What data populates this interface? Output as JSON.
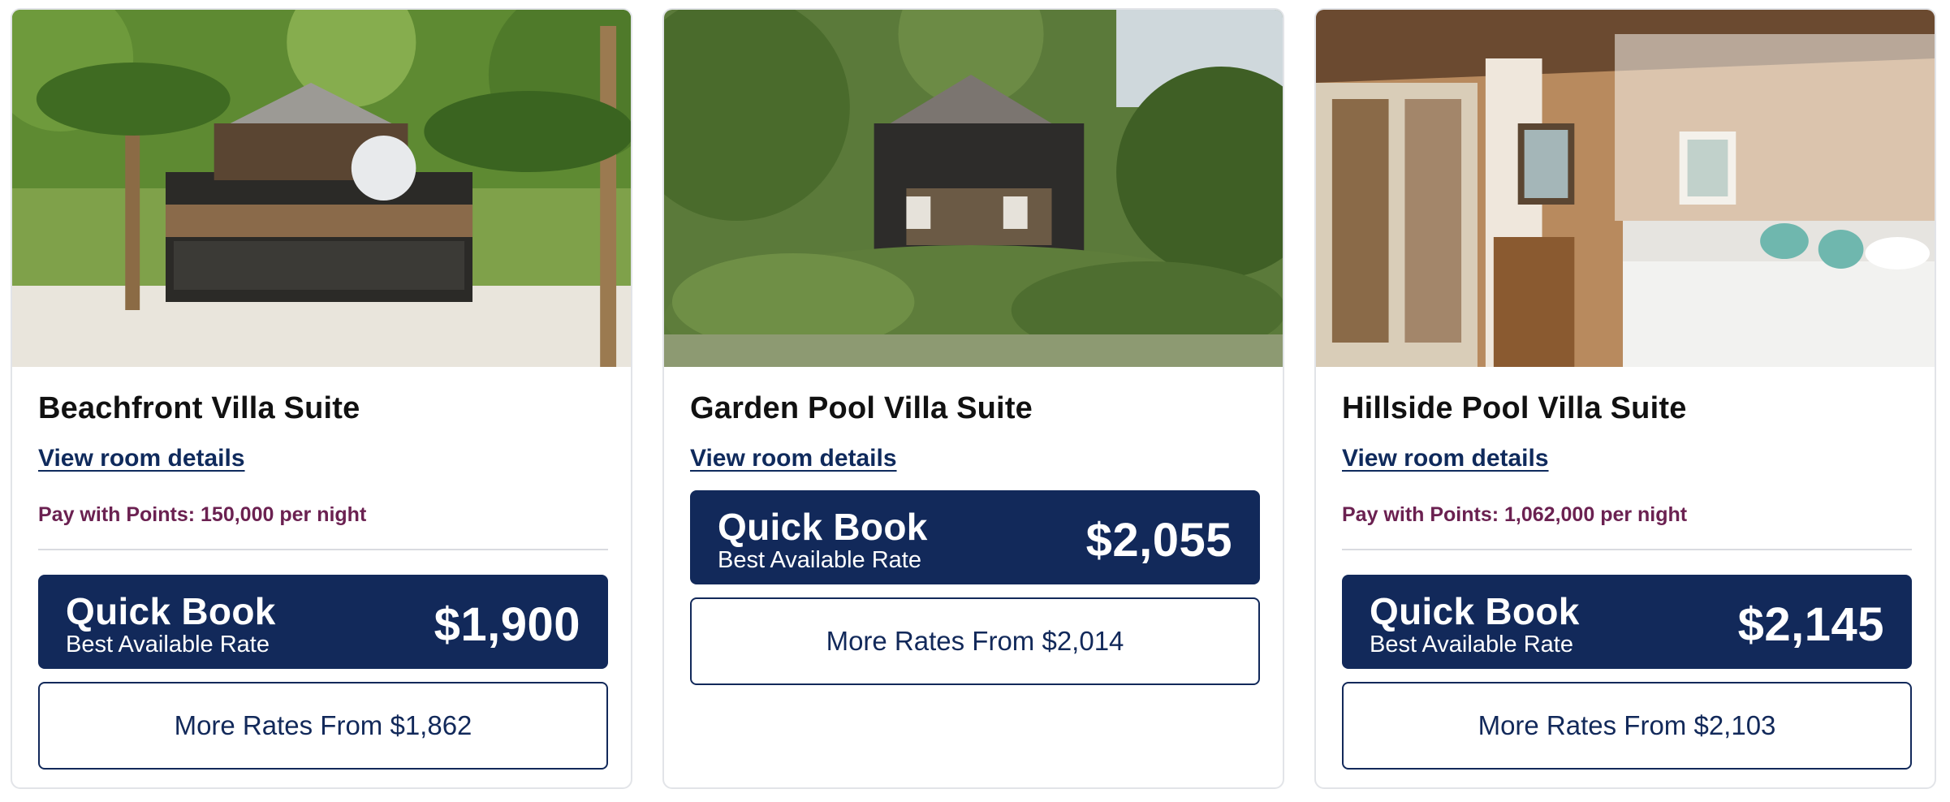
{
  "rooms": [
    {
      "name": "Beachfront Villa Suite",
      "details_link": "View room details",
      "points_text": "Pay with Points: 150,000 per night",
      "quick_book_title": "Quick Book",
      "quick_book_subtitle": "Best Available Rate",
      "quick_book_price": "$1,900",
      "more_rates": "More Rates From $1,862"
    },
    {
      "name": "Garden Pool Villa Suite",
      "details_link": "View room details",
      "points_text": "",
      "quick_book_title": "Quick Book",
      "quick_book_subtitle": "Best Available Rate",
      "quick_book_price": "$2,055",
      "more_rates": "More Rates From $2,014"
    },
    {
      "name": "Hillside Pool Villa Suite",
      "details_link": "View room details",
      "points_text": "Pay with Points: 1,062,000 per night",
      "quick_book_title": "Quick Book",
      "quick_book_subtitle": "Best Available Rate",
      "quick_book_price": "$2,145",
      "more_rates": "More Rates From $2,103"
    }
  ],
  "colors": {
    "primary_navy": "#12295a",
    "points_plum": "#6b2151",
    "link_navy": "#0f2a5c"
  }
}
